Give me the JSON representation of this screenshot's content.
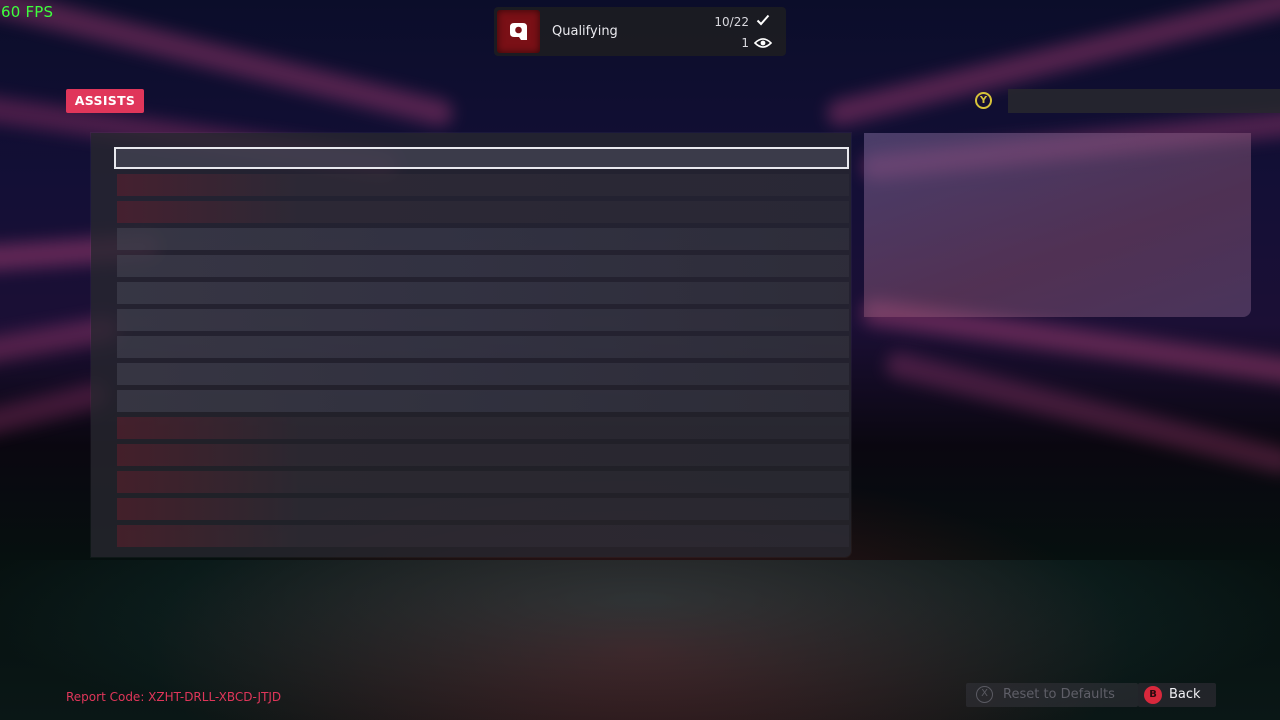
{
  "hud": {
    "fps": "60 FPS"
  },
  "session": {
    "title": "Qualifying",
    "progress": "10/22",
    "viewers": "1",
    "icon": "qualifying-q-icon"
  },
  "section": {
    "label": "ASSISTS"
  },
  "y_action": {
    "button": "Y"
  },
  "settings_rows": [
    {
      "selected": true,
      "tone": "neutral"
    },
    {
      "tone": "red"
    },
    {
      "tone": "red"
    },
    {
      "tone": "neutral"
    },
    {
      "tone": "neutral"
    },
    {
      "tone": "neutral"
    },
    {
      "tone": "neutral"
    },
    {
      "tone": "neutral"
    },
    {
      "tone": "neutral"
    },
    {
      "tone": "neutral"
    },
    {
      "tone": "red"
    },
    {
      "tone": "red"
    },
    {
      "tone": "red"
    },
    {
      "tone": "red"
    },
    {
      "tone": "red"
    }
  ],
  "footer": {
    "report_code": "Report Code: XZHT-DRLL-XBCD-JTJD",
    "reset_button": "X",
    "reset_label": "Reset to Defaults",
    "back_button": "B",
    "back_label": "Back"
  },
  "colors": {
    "accent": "#e0365a",
    "fps": "#3dff3d",
    "y_button": "#d7c33a",
    "b_button": "#d8283c"
  }
}
